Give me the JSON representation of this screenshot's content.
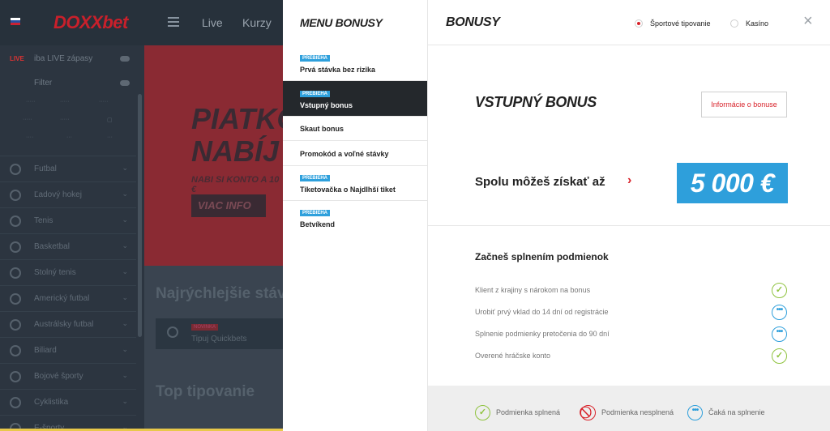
{
  "background_site": {
    "logo": "DOXXbet",
    "nav": [
      "Live",
      "Kurzy"
    ],
    "sidebar": {
      "live_label": "LIVE",
      "live_toggle_text": "iba LIVE zápasy",
      "filter_text": "Filter",
      "sports": [
        "Futbal",
        "Ľadový hokej",
        "Tenis",
        "Basketbal",
        "Stolný tenis",
        "Americký futbal",
        "Austrálsky futbal",
        "Biliard",
        "Bojové športy",
        "Cyklistika",
        "E-športy"
      ]
    },
    "hero": {
      "line1": "PIATKO",
      "line2": "NABÍJ",
      "sub": "NABI SI KONTO A 10 €",
      "button": "VIAC INFO"
    },
    "sections": {
      "fastest": "Najrýchlejšie stávky",
      "quickbet_tag": "NOVINKA",
      "quickbet_label": "Tipuj Quickbets",
      "top": "Top tipovanie"
    }
  },
  "menu": {
    "title": "MENU BONUSY",
    "items": [
      {
        "tag": "PREBIEHA",
        "label": "Prvá stávka bez rizika"
      },
      {
        "tag": "PREBIEHA",
        "label": "Vstupný bonus"
      },
      {
        "tag": "",
        "label": "Skaut bonus"
      },
      {
        "tag": "",
        "label": "Promokód a voľné stávky"
      },
      {
        "tag": "PREBIEHA",
        "label": "Tiketovačka o Najdlhší tiket"
      },
      {
        "tag": "PREBIEHA",
        "label": "Betvíkend"
      }
    ]
  },
  "panel": {
    "title": "BONUSY",
    "radio_sport": "Športové tipovanie",
    "radio_casino": "Kasíno",
    "close": "×",
    "bonus_title": "VSTUPNÝ BONUS",
    "info_button": "Informácie o bonuse",
    "can_get_text": "Spolu môžeš získať až",
    "amount": "5 000 €",
    "conditions_title": "Začneš splnením podmienok",
    "conditions": [
      {
        "label": "Klient z krajiny s nárokom na bonus",
        "status": "done"
      },
      {
        "label": "Urobiť prvý vklad do 14 dní od registrácie",
        "status": "waiting"
      },
      {
        "label": "Splnenie podmienky pretočenia do 90 dní",
        "status": "waiting"
      },
      {
        "label": "Overené hráčske konto",
        "status": "done"
      }
    ],
    "legend": {
      "done": "Podmienka splnená",
      "failed": "Podmienka nesplnená",
      "waiting": "Čaká na splnenie"
    }
  },
  "colors": {
    "accent_red": "#d8222a",
    "accent_blue": "#2e9fdb",
    "success_green": "#8fc33f",
    "menu_active": "#24282c"
  },
  "icons": {
    "done": "check-circle-icon",
    "failed": "ban-icon",
    "waiting": "dots-circle-icon"
  }
}
